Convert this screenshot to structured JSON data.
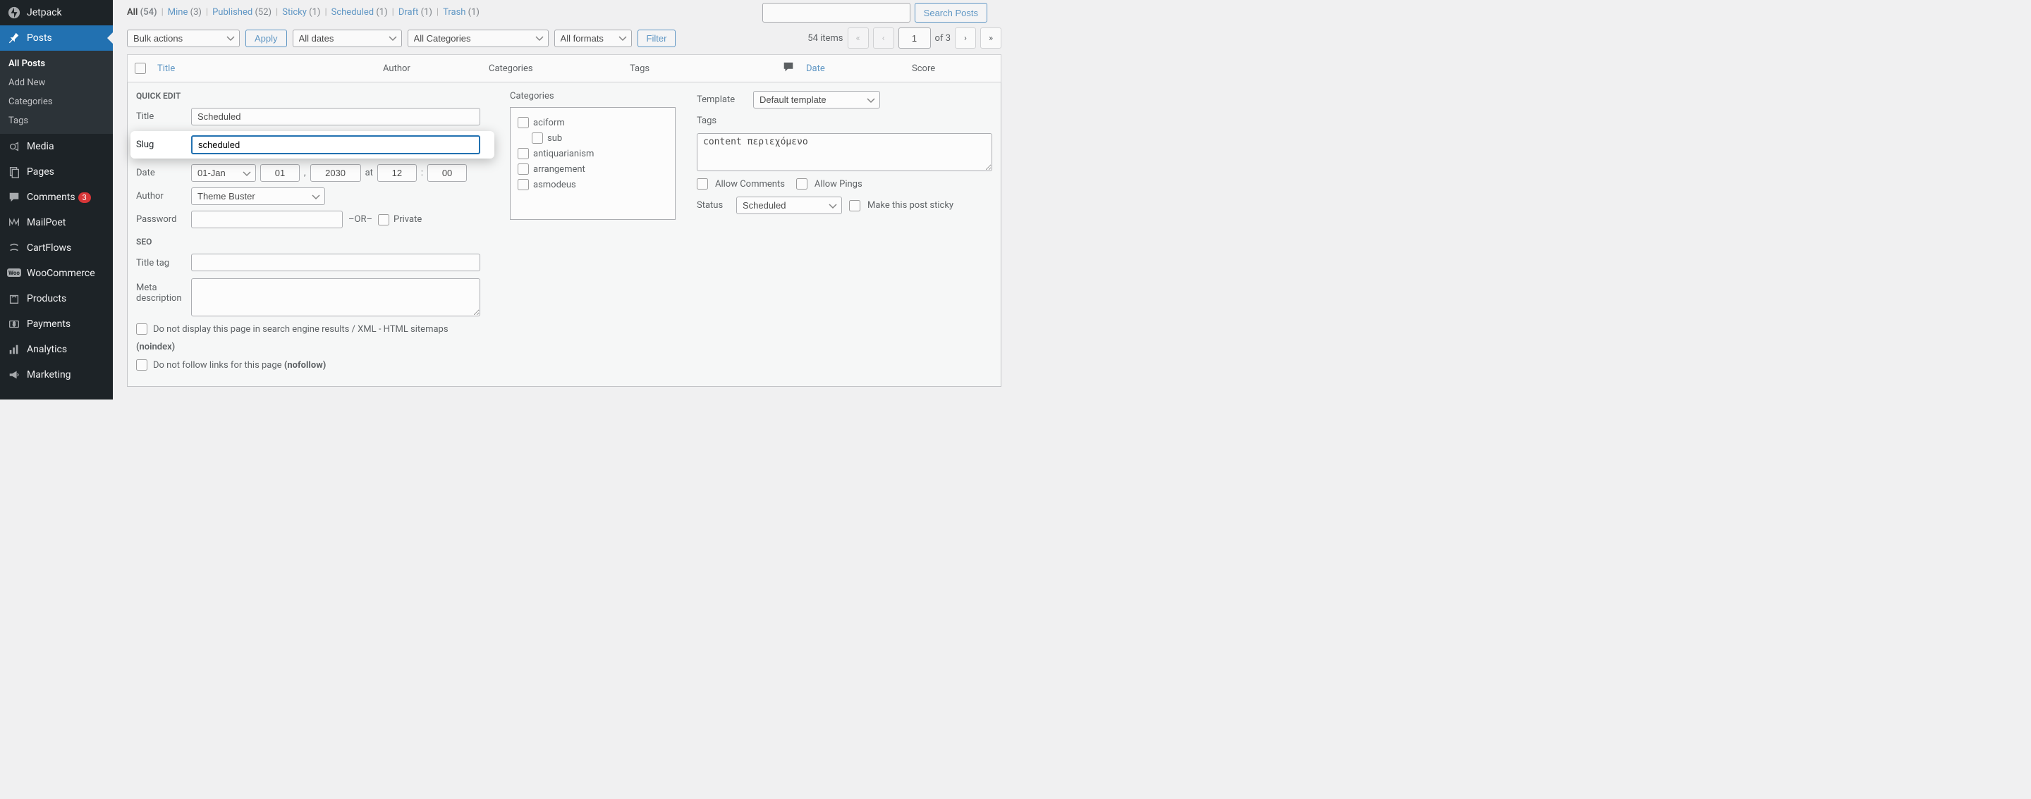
{
  "sidebar": {
    "items": [
      {
        "label": "Jetpack",
        "icon": "jetpack"
      },
      {
        "label": "Posts",
        "icon": "pin"
      },
      {
        "label": "Media",
        "icon": "media"
      },
      {
        "label": "Pages",
        "icon": "pages"
      },
      {
        "label": "Comments",
        "icon": "comment",
        "badge": "3"
      },
      {
        "label": "MailPoet",
        "icon": "mailpoet"
      },
      {
        "label": "CartFlows",
        "icon": "cartflows"
      },
      {
        "label": "WooCommerce",
        "icon": "woo"
      },
      {
        "label": "Products",
        "icon": "products"
      },
      {
        "label": "Payments",
        "icon": "payments"
      },
      {
        "label": "Analytics",
        "icon": "analytics"
      },
      {
        "label": "Marketing",
        "icon": "marketing"
      }
    ],
    "sub": [
      "All Posts",
      "Add New",
      "Categories",
      "Tags"
    ]
  },
  "filters": [
    {
      "label": "All",
      "count": "(54)",
      "active": true
    },
    {
      "label": "Mine",
      "count": "(3)"
    },
    {
      "label": "Published",
      "count": "(52)"
    },
    {
      "label": "Sticky",
      "count": "(1)"
    },
    {
      "label": "Scheduled",
      "count": "(1)"
    },
    {
      "label": "Draft",
      "count": "(1)"
    },
    {
      "label": "Trash",
      "count": "(1)"
    }
  ],
  "search": {
    "button": "Search Posts"
  },
  "toolbar": {
    "bulk": "Bulk actions",
    "apply": "Apply",
    "dates": "All dates",
    "categories": "All Categories",
    "formats": "All formats",
    "filter": "Filter"
  },
  "pagination": {
    "items": "54 items",
    "page": "1",
    "of": "of 3"
  },
  "columns": {
    "title": "Title",
    "author": "Author",
    "categories": "Categories",
    "tags": "Tags",
    "date": "Date",
    "score": "Score"
  },
  "quickedit": {
    "heading": "QUICK EDIT",
    "title_label": "Title",
    "title_value": "Scheduled",
    "slug_label": "Slug",
    "slug_value": "scheduled",
    "date_label": "Date",
    "month": "01-Jan",
    "day": "01",
    "year": "2030",
    "at": "at",
    "hour": "12",
    "minute": "00",
    "author_label": "Author",
    "author_value": "Theme Buster",
    "password_label": "Password",
    "or": "–OR–",
    "private": "Private",
    "categories_heading": "Categories",
    "cats": [
      {
        "label": "aciform"
      },
      {
        "label": "sub",
        "sub": true
      },
      {
        "label": "antiquarianism"
      },
      {
        "label": "arrangement"
      },
      {
        "label": "asmodeus"
      }
    ],
    "template_label": "Template",
    "template_value": "Default template",
    "tags_label": "Tags",
    "tags_value": "content περιεχόμενο",
    "allow_comments": "Allow Comments",
    "allow_pings": "Allow Pings",
    "status_label": "Status",
    "status_value": "Scheduled",
    "sticky": "Make this post sticky"
  },
  "seo": {
    "heading": "SEO",
    "title_tag": "Title tag",
    "meta_desc": "Meta description",
    "noindex": "Do not display this page in search engine results / XML - HTML sitemaps",
    "noindex_tag": "(noindex)",
    "nofollow": "Do not follow links for this page",
    "nofollow_tag": "(nofollow)"
  }
}
